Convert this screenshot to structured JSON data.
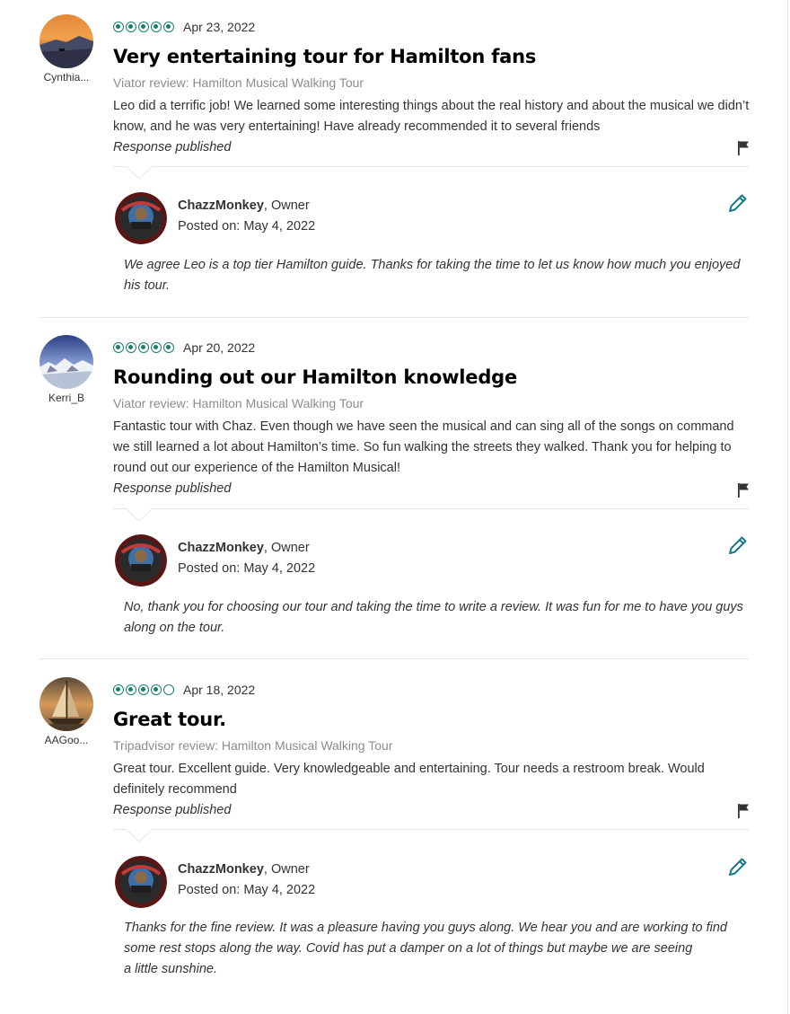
{
  "reviews": [
    {
      "reviewer": "Cynthia...",
      "rating": 5,
      "date": "Apr 23, 2022",
      "title": "Very entertaining tour for Hamilton fans",
      "source": "Viator review: Hamilton Musical Walking Tour",
      "text": "Leo did a terrific job! We learned some interesting things about the real history and about the musical we didn’t know, and he was very entertaining! Have already recommended it to several friends",
      "status": "Response published",
      "response": {
        "owner_name": "ChazzMonkey",
        "owner_role": ", Owner",
        "posted_label": "Posted on:",
        "posted_date": "May 4, 2022",
        "text": "We agree Leo is a top tier Hamilton guide. Thanks for taking the time to let us know how much you enjoyed his tour."
      }
    },
    {
      "reviewer": "Kerri_B",
      "rating": 5,
      "date": "Apr 20, 2022",
      "title": "Rounding out our Hamilton knowledge",
      "source": "Viator review: Hamilton Musical Walking Tour",
      "text": "Fantastic tour with Chaz. Even though we have seen the musical and can sing all of the songs on command we still learned a lot about Hamilton’s time. So fun walking the streets they walked. Thank you for helping to round out our experience of the Hamilton Musical!",
      "status": "Response published",
      "response": {
        "owner_name": "ChazzMonkey",
        "owner_role": ", Owner",
        "posted_label": "Posted on:",
        "posted_date": "May 4, 2022",
        "text": "No, thank you for choosing our tour and taking the time to write a review. It was fun for me to have you guys along on the tour."
      }
    },
    {
      "reviewer": "AAGoo...",
      "rating": 4,
      "date": "Apr 18, 2022",
      "title": "Great tour.",
      "source": "Tripadvisor review: Hamilton Musical Walking Tour",
      "text": "Great tour. Excellent guide. Very knowledgeable and entertaining. Tour needs a restroom break. Would definitely recommend",
      "status": "Response published",
      "response": {
        "owner_name": "ChazzMonkey",
        "owner_role": ", Owner",
        "posted_label": "Posted on:",
        "posted_date": "May 4, 2022",
        "text_line1": "Thanks for the fine review. It was a pleasure having you guys along. We hear you and are working to find some rest stops along the way. Covid has put a damper on a lot of things but maybe we are seeing",
        "text_line2": "a little sunshine."
      }
    }
  ],
  "colors": {
    "bubble": "#17806a",
    "pencil": "#1a7a8a",
    "divider": "#e5e5e5"
  },
  "icons": {
    "flag": "flag-icon",
    "edit": "pencil-icon"
  }
}
